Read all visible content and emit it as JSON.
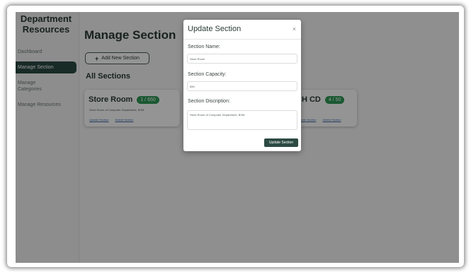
{
  "sidebar": {
    "brand_line1": "Department",
    "brand_line2": "Resources",
    "items": [
      {
        "label": "Dashboard"
      },
      {
        "label": "Manage Section"
      },
      {
        "label": "Manage\nCategories"
      },
      {
        "label": "Manage Resources"
      }
    ]
  },
  "main": {
    "title": "Manage Section",
    "add_button": "Add New Section",
    "add_icon": "+",
    "subtitle": "All Sections",
    "cards": [
      {
        "title": "Store Room",
        "badge": "1 / 650",
        "description": "Store Room of Computer Department, BVM",
        "update_link": "Update Section",
        "delete_link": "Delete Section"
      },
      {
        "title": "CH CD",
        "badge": "4 / 50",
        "update_link": "Update Section",
        "delete_link": "Delete Section"
      }
    ]
  },
  "modal": {
    "title": "Update Section",
    "close_icon": "×",
    "name_label": "Section Name:",
    "name_value": "Store Room",
    "capacity_label": "Section Capacity:",
    "capacity_value": "650",
    "description_label": "Section Discription:",
    "description_value": "Store Room of Computer Department, BVM",
    "submit_label": "Update Section"
  },
  "colors": {
    "primary": "#2c4a42",
    "badge": "#2f9a57",
    "link": "#3a6aa8"
  }
}
